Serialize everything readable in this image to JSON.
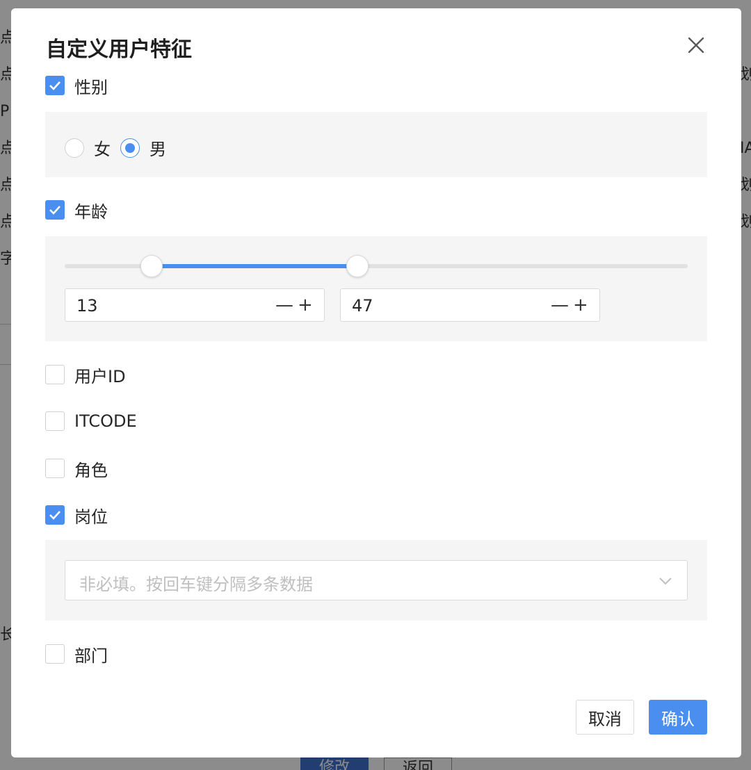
{
  "dialog": {
    "title": "自定义用户特征",
    "close_icon": "close-icon"
  },
  "background": {
    "left_fragments": [
      "点",
      "点",
      "P",
      "点",
      "点",
      "点",
      "字"
    ],
    "right_fragments": [
      "",
      "划",
      "",
      "IA",
      "划",
      "划",
      ""
    ],
    "bottom_left_fragment": "长",
    "modify_label": "修改",
    "back_label": "返回"
  },
  "gender": {
    "label": "性别",
    "checked": true,
    "options": [
      {
        "label": "女",
        "selected": false
      },
      {
        "label": "男",
        "selected": true
      }
    ]
  },
  "age": {
    "label": "年龄",
    "checked": true,
    "min_value": "13",
    "max_value": "47",
    "range_start_fraction": 0.14,
    "range_end_fraction": 0.47,
    "minus_label": "—",
    "plus_label": "+"
  },
  "user_id": {
    "label": "用户ID",
    "checked": false
  },
  "itcode": {
    "label": "ITCODE",
    "checked": false
  },
  "role": {
    "label": "角色",
    "checked": false
  },
  "position": {
    "label": "岗位",
    "checked": true,
    "placeholder": "非必填。按回车键分隔多条数据"
  },
  "department": {
    "label": "部门",
    "checked": false
  },
  "footer": {
    "cancel_label": "取消",
    "confirm_label": "确认"
  },
  "colors": {
    "accent": "#4a8ff0",
    "panel": "#f5f5f5"
  }
}
